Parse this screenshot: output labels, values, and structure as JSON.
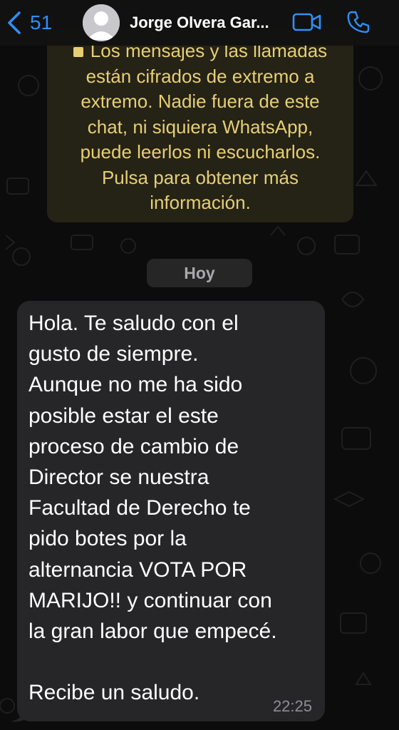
{
  "header": {
    "back_count": "51",
    "contact_name": "Jorge Olvera Gar...",
    "accent_color": "#2f8ff5"
  },
  "encryption_notice": {
    "lines": [
      "Los mensajes y las llamadas",
      "están cifrados de extremo a",
      "extremo. Nadie fuera de este",
      "chat, ni siquiera WhatsApp,",
      "puede leerlos ni escucharlos.",
      "Pulsa para obtener más",
      "información."
    ],
    "text_color": "#e6cf73",
    "icon": "lock-icon"
  },
  "date_separator": "Hoy",
  "message": {
    "text": "Hola. Te saludo con el\ngusto de siempre.\nAunque no me ha sido\nposible estar el este\nproceso de cambio de\nDirector se nuestra\nFacultad de Derecho te\npido botes por la\nalternancia  VOTA POR\nMARIJO!! y continuar con\nla gran labor que empecé.\n\nRecibe un saludo.",
    "time": "22:25"
  }
}
